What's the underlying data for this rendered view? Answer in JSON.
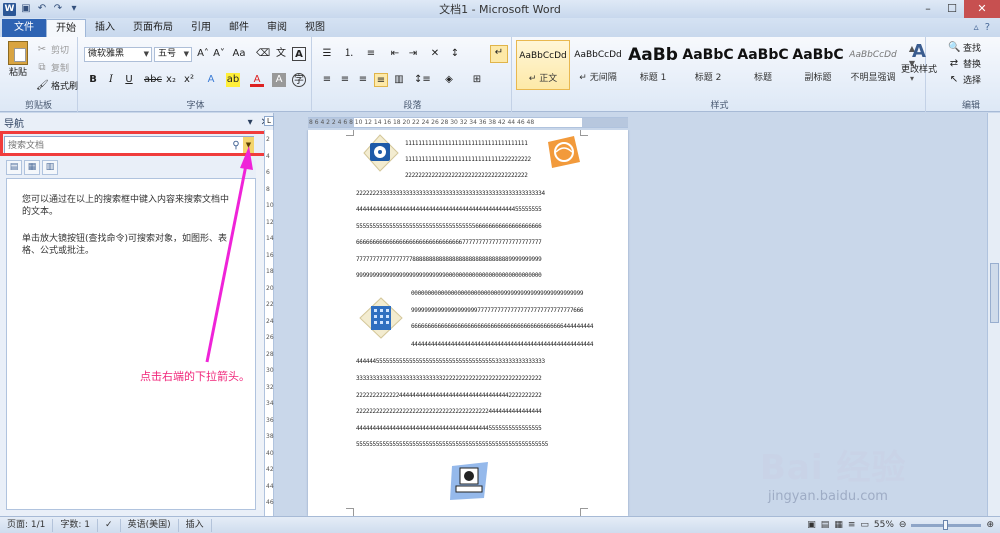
{
  "window": {
    "title": "文档1 - Microsoft Word",
    "controls": [
      "–",
      "☐",
      "✕"
    ]
  },
  "tabs": [
    "文件",
    "开始",
    "插入",
    "页面布局",
    "引用",
    "邮件",
    "审阅",
    "视图"
  ],
  "ribbon": {
    "clipboard": {
      "paste": "粘贴",
      "cut": "剪切",
      "copy": "复制",
      "format_painter": "格式刷",
      "label": "剪贴板"
    },
    "font": {
      "name": "微软雅黑",
      "size": "五号",
      "label": "字体"
    },
    "paragraph": {
      "label": "段落"
    },
    "styles": {
      "label": "样式",
      "items": [
        {
          "sample": "AaBbCcDd",
          "name": "↵ 正文"
        },
        {
          "sample": "AaBbCcDd",
          "name": "↵ 无间隔"
        },
        {
          "sample": "AaBb",
          "name": "标题 1"
        },
        {
          "sample": "AaBbC",
          "name": "标题 2"
        },
        {
          "sample": "AaBbC",
          "name": "标题"
        },
        {
          "sample": "AaBbC",
          "name": "副标题"
        },
        {
          "sample": "AaBbCcDd",
          "name": "不明显强调"
        }
      ],
      "change_styles": "更改样式"
    },
    "editing": {
      "find": "查找",
      "replace": "替换",
      "select": "选择",
      "label": "编辑"
    }
  },
  "nav": {
    "title": "导航",
    "search_placeholder": "搜索文档",
    "text1": "您可以通过在以上的搜索框中键入内容来搜索文档中的文本。",
    "text2": "单击放大镜按钮(查找命令)可搜索对象，如图形、表格、公式或批注。"
  },
  "ruler": {
    "h_nums": "8  6  4  2     2  4  6  8  10  12  14  16  18  20  22  24  26  28  30  32  34  36  38     42  44  46  48",
    "v_nums": [
      "2",
      "4",
      "6",
      "8",
      "10",
      "12",
      "14",
      "16",
      "18",
      "20",
      "22",
      "24",
      "26",
      "28",
      "30",
      "32",
      "34",
      "36",
      "38",
      "40",
      "42",
      "44",
      "46"
    ]
  },
  "document": {
    "lines": [
      "1111111111111111111111111111111111111",
      "11111111111111111111111111111222222222",
      "2222222222222222222222222222222222222",
      "222222233333333333333333333333333333333333333333333333334",
      "44444444444444444444444444444444444444444444444455555555",
      "55555555555555555555555555555555555566666666666666666666",
      "66666666666666666666666666666666777777777777777777777777",
      "77777777777777777888888888888888888888888888889999999999",
      "99999999999999999999999999900000000000000000000000000000",
      "0000000000000000000000000009999999999999999999999999",
      "9999999999999999999977777777777777777777777777777666",
      "6666666666666666666666666666666666666666666666444444444",
      "4444444444444444444444444444444444444444444444444444444",
      "444444555555555555555555555555555555555555333333333333333",
      "33333333333333333333333333222222222222222222222222222222",
      "22222222222224444444444444444444444444444444442222222222",
      "22222222222222222222222222222222222222224444444444444444",
      "44444444444444444444444444444444444444445555555555555555",
      "5555555555555555555555555555555555555555555555555555555555"
    ]
  },
  "annotation": "点击右端的下拉箭头。",
  "watermark": {
    "main": "Bai 经验",
    "sub": "jingyan.baidu.com"
  },
  "status": {
    "page": "页面: 1/1",
    "words": "字数: 1",
    "lang": "英语(美国)",
    "mode": "插入",
    "zoom": "55%"
  }
}
